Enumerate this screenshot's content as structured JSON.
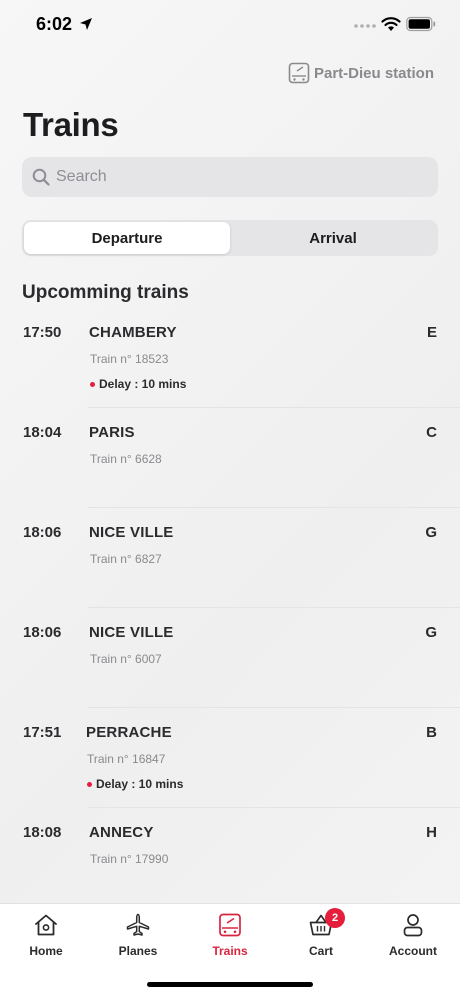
{
  "status_bar": {
    "time": "6:02"
  },
  "header": {
    "station_label": "Part-Dieu station",
    "title": "Trains"
  },
  "search": {
    "placeholder": "Search"
  },
  "segments": [
    {
      "label": "Departure",
      "active": true
    },
    {
      "label": "Arrival",
      "active": false
    }
  ],
  "section_title": "Upcomming trains",
  "trains": [
    {
      "time": "17:50",
      "destination": "CHAMBERY",
      "number": "Train n° 18523",
      "platform": "E",
      "delay": "Delay : 10 mins"
    },
    {
      "time": "18:04",
      "destination": "PARIS",
      "number": "Train n° 6628",
      "platform": "C",
      "delay": ""
    },
    {
      "time": "18:06",
      "destination": "NICE VILLE",
      "number": "Train n° 6827",
      "platform": "G",
      "delay": ""
    },
    {
      "time": "18:06",
      "destination": "NICE VILLE",
      "number": "Train n° 6007",
      "platform": "G",
      "delay": ""
    },
    {
      "time": "17:51",
      "destination": "PERRACHE",
      "number": "Train n° 16847",
      "platform": "B",
      "delay": "Delay : 10 mins"
    },
    {
      "time": "18:08",
      "destination": "ANNECY",
      "number": "Train n° 17990",
      "platform": "H",
      "delay": ""
    }
  ],
  "tab_bar": {
    "items": [
      {
        "label": "Home",
        "icon": "home-icon"
      },
      {
        "label": "Planes",
        "icon": "plane-icon"
      },
      {
        "label": "Trains",
        "icon": "train-icon",
        "active": true
      },
      {
        "label": "Cart",
        "icon": "cart-icon",
        "badge": "2"
      },
      {
        "label": "Account",
        "icon": "account-icon"
      }
    ]
  },
  "colors": {
    "accent": "#e41e3c",
    "active_tab": "#d8253f",
    "muted": "#8a8a8e"
  }
}
